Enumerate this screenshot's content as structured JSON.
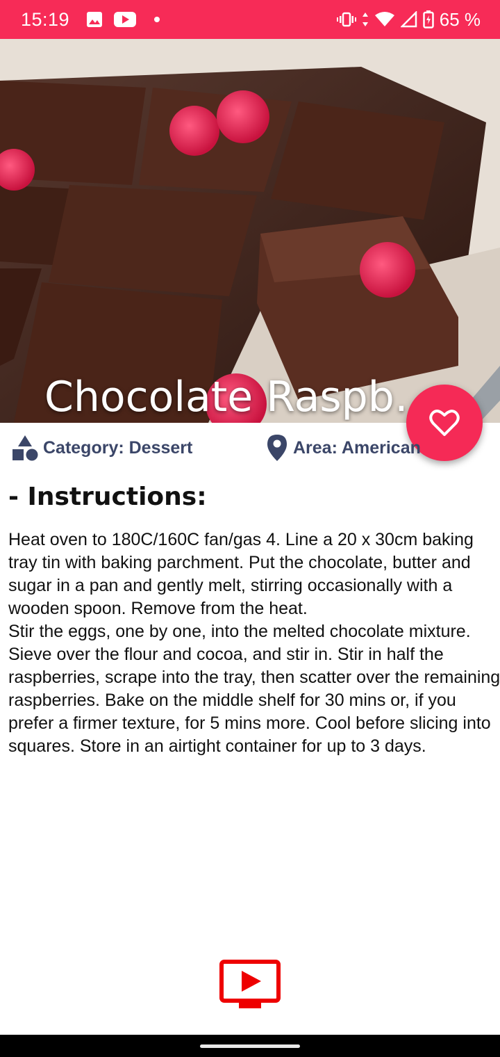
{
  "status_bar": {
    "time": "15:19",
    "battery": "65 %",
    "icons": [
      "image-icon",
      "youtube-icon",
      "vibrate-icon",
      "wifi-icon",
      "signal-icon",
      "battery-icon"
    ]
  },
  "recipe": {
    "title": "Chocolate Raspb…",
    "category": "Category: Dessert",
    "area": "Area: American",
    "instructions_heading": "- Instructions:",
    "instructions": "Heat oven to 180C/160C fan/gas 4. Line a 20 x 30cm baking tray tin with baking parchment. Put the chocolate, butter and sugar in a pan and gently melt, stirring occasionally with a wooden spoon. Remove from the heat.\nStir the eggs, one by one, into the melted chocolate mixture. Sieve over the flour and cocoa, and stir in. Stir in half the raspberries, scrape into the tray, then scatter over the remaining raspberries. Bake on the middle shelf for 30 mins or, if you prefer a firmer texture, for 5 mins more. Cool before slicing into squares. Store in an airtight container for up to 3 days."
  },
  "colors": {
    "accent": "#f72b57",
    "meta_text": "#3b4668",
    "video_red": "#ee0000"
  }
}
